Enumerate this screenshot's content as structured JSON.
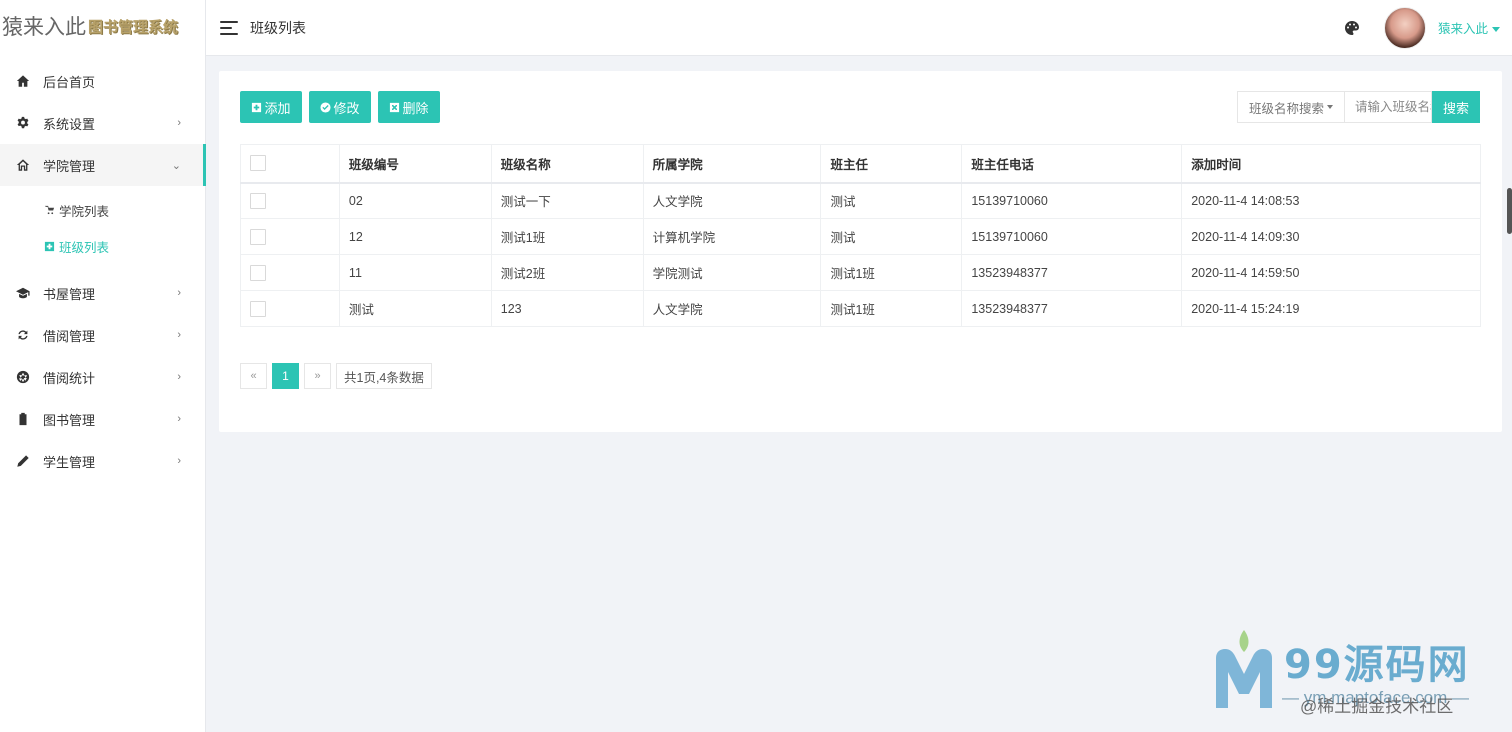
{
  "sidebar": {
    "logo_main": "猿来入此",
    "logo_sub": "图书管理系统",
    "items": [
      {
        "label": "后台首页",
        "icon": "home-icon"
      },
      {
        "label": "系统设置",
        "icon": "gear-icon",
        "chevron": "›"
      },
      {
        "label": "学院管理",
        "icon": "house-outline-icon",
        "chevron": "⌄"
      },
      {
        "label": "书屋管理",
        "icon": "graduation-cap-icon",
        "chevron": "›"
      },
      {
        "label": "借阅管理",
        "icon": "refresh-icon",
        "chevron": "›"
      },
      {
        "label": "借阅统计",
        "icon": "aperture-icon",
        "chevron": "›"
      },
      {
        "label": "图书管理",
        "icon": "battery-icon",
        "chevron": "›"
      },
      {
        "label": "学生管理",
        "icon": "pencil-icon",
        "chevron": "›"
      }
    ],
    "sub_items": [
      {
        "label": "学院列表",
        "icon": "stroller-icon"
      },
      {
        "label": "班级列表",
        "icon": "plus-square-icon"
      }
    ]
  },
  "header": {
    "page_title": "班级列表",
    "username": "猿来入此"
  },
  "toolbar": {
    "add": "添加",
    "edit": "修改",
    "delete": "删除"
  },
  "search": {
    "field_label": "班级名称搜索",
    "placeholder": "请输入班级名称",
    "button": "搜索"
  },
  "table": {
    "columns": [
      "班级编号",
      "班级名称",
      "所属学院",
      "班主任",
      "班主任电话",
      "添加时间"
    ],
    "rows": [
      [
        "02",
        "测试一下",
        "人文学院",
        "测试",
        "15139710060",
        "2020-11-4 14:08:53"
      ],
      [
        "12",
        "测试1班",
        "计算机学院",
        "测试",
        "15139710060",
        "2020-11-4 14:09:30"
      ],
      [
        "11",
        "测试2班",
        "学院测试",
        "测试1班",
        "13523948377",
        "2020-11-4 14:59:50"
      ],
      [
        "测试",
        "123",
        "人文学院",
        "测试1班",
        "13523948377",
        "2020-11-4 15:24:19"
      ]
    ]
  },
  "pager": {
    "prev": "«",
    "current": "1",
    "next": "»",
    "info": "共1页,4条数据"
  },
  "watermark": {
    "brand": "99源码网",
    "line": "— ym.maptoface.com —",
    "credit": "@稀土掘金技术社区"
  },
  "colors": {
    "accent": "#2cc4b4"
  }
}
